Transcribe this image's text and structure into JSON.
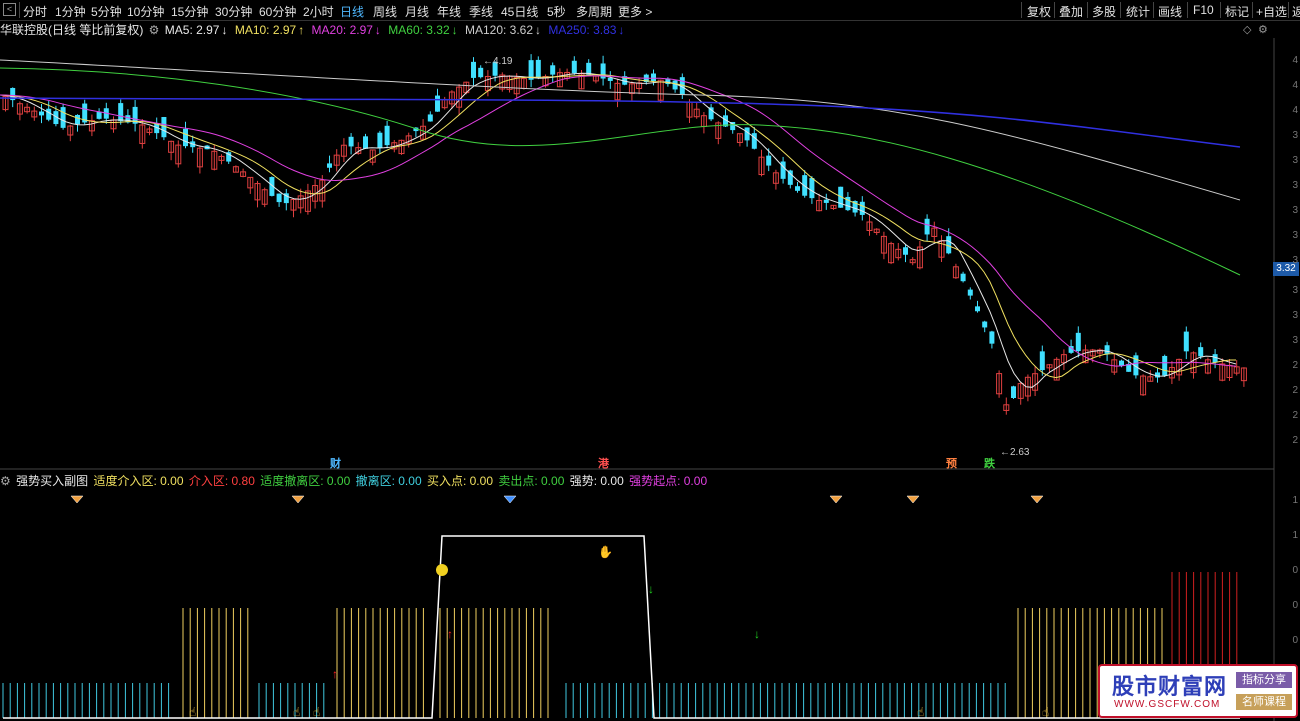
{
  "toolbar": {
    "periods": [
      "分时",
      "1分钟",
      "5分钟",
      "10分钟",
      "15分钟",
      "30分钟",
      "60分钟",
      "2小时",
      "日线",
      "周线",
      "月线",
      "年线",
      "季线",
      "45日线",
      "5秒",
      "多周期",
      "更多 >"
    ],
    "active_period": "日线",
    "right_buttons": [
      "复权",
      "叠加",
      "多股",
      "统计",
      "画线",
      "F10",
      "标记",
      "+自选",
      "返"
    ]
  },
  "main_legend": {
    "stock": "华联控股(日线 等比前复权)",
    "ma": [
      {
        "label": "MA5: 2.97",
        "arrow": "↓",
        "color": "#e8e8e8"
      },
      {
        "label": "MA10: 2.97",
        "arrow": "↑",
        "color": "#f0e060"
      },
      {
        "label": "MA20: 2.97",
        "arrow": "↓",
        "color": "#e040e0"
      },
      {
        "label": "MA60: 3.32",
        "arrow": "↓",
        "color": "#40d040"
      },
      {
        "label": "MA120: 3.62",
        "arrow": "↓",
        "color": "#cccccc"
      },
      {
        "label": "MA250: 3.83",
        "arrow": "↓",
        "color": "#3030e0"
      }
    ]
  },
  "annotations": {
    "high": "4.19",
    "low": "2.63",
    "markers": [
      {
        "text": "财",
        "color": "#4fb8ff"
      },
      {
        "text": "港",
        "color": "#ff5050"
      },
      {
        "text": "预",
        "color": "#ff8040"
      },
      {
        "text": "跌",
        "color": "#40d040"
      }
    ]
  },
  "price_tag": "3.32",
  "right_scale": [
    "4",
    "4",
    "4",
    "3",
    "3",
    "3",
    "3",
    "3",
    "3",
    "3",
    "3",
    "3",
    "2",
    "2",
    "2",
    "2"
  ],
  "right_scale_sub": [
    "1",
    "1",
    "0",
    "0",
    "0",
    "0"
  ],
  "sub_legend": {
    "name": "强势买入副图",
    "items": [
      {
        "label": "适度介入区: 0.00",
        "color": "#f0e060"
      },
      {
        "label": "介入区: 0.80",
        "color": "#ff4040"
      },
      {
        "label": "适度撤离区: 0.00",
        "color": "#40d040"
      },
      {
        "label": "撤离区: 0.00",
        "color": "#40d0e0"
      },
      {
        "label": "买入点: 0.00",
        "color": "#f0e060"
      },
      {
        "label": "卖出点: 0.00",
        "color": "#40d040"
      },
      {
        "label": "强势: 0.00",
        "color": "#e8e8e8"
      },
      {
        "label": "强势起点: 0.00",
        "color": "#e040e0"
      }
    ]
  },
  "logo": {
    "title": "股市财富网",
    "url": "WWW.GSCFW.COM",
    "tag1": "指标分享",
    "tag2": "名师课程"
  },
  "colors": {
    "up": "#e04040",
    "down": "#40e0ff",
    "ma5": "#e8e8e8",
    "ma10": "#f0e060",
    "ma20": "#e040e0",
    "ma60": "#40d040",
    "ma120": "#cccccc",
    "ma250": "#3030e0"
  }
}
